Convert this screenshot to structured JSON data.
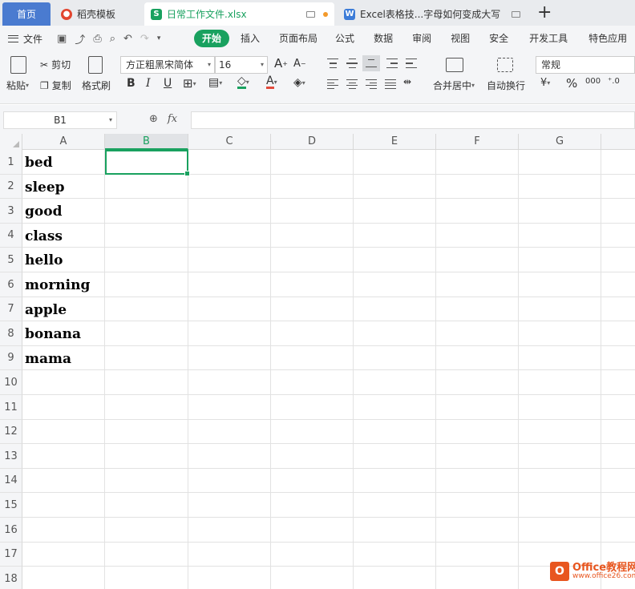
{
  "tabs": {
    "home": "首页",
    "template": "稻壳模板",
    "active_file": "日常工作文件.xlsx",
    "doc": "Excel表格技...字母如何变成大写",
    "new_tab": "+"
  },
  "menu": {
    "file": "文件",
    "items": [
      "开始",
      "插入",
      "页面布局",
      "公式",
      "数据",
      "审阅",
      "视图",
      "安全",
      "开发工具",
      "特色应用"
    ]
  },
  "ribbon": {
    "paste": "粘贴",
    "cut": "剪切",
    "copy": "复制",
    "format_painter": "格式刷",
    "font_name": "方正粗黑宋简体",
    "font_size": "16",
    "merge_center": "合并居中",
    "wrap_text": "自动换行",
    "number_format": "常规"
  },
  "formula_bar": {
    "name_box": "B1",
    "fx": "fx",
    "value": ""
  },
  "columns": [
    "A",
    "B",
    "C",
    "D",
    "E",
    "F",
    "G"
  ],
  "selected_column": "B",
  "rows": [
    "1",
    "2",
    "3",
    "4",
    "5",
    "6",
    "7",
    "8",
    "9",
    "10",
    "11",
    "12",
    "13",
    "14",
    "15",
    "16",
    "17",
    "18"
  ],
  "cells_A": [
    "bed",
    "sleep",
    "good",
    "class",
    "hello",
    "morning",
    "apple",
    "bonana",
    "mama"
  ],
  "watermark": {
    "title": "Office教程网",
    "url": "www.office26.com"
  },
  "colors": {
    "accent": "#19a15f",
    "home_tab": "#4a7bd0",
    "watermark": "#e8561f"
  }
}
